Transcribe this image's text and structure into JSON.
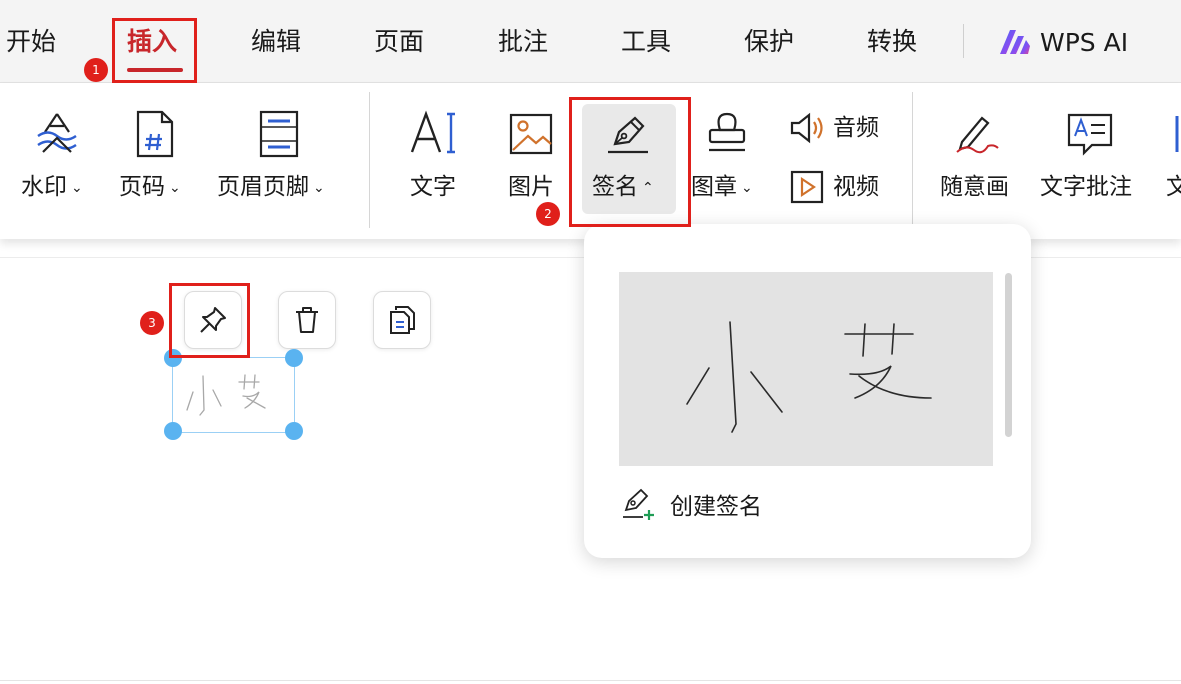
{
  "menu": {
    "tabs": [
      "开始",
      "插入",
      "编辑",
      "页面",
      "批注",
      "工具",
      "保护",
      "转换"
    ],
    "active": "插入",
    "ai_label": "WPS AI"
  },
  "ribbon": {
    "watermark": "水印",
    "page_number": "页码",
    "header_footer": "页眉页脚",
    "text": "文字",
    "image": "图片",
    "signature": "签名",
    "stamp": "图章",
    "audio": "音频",
    "video": "视频",
    "freehand": "随意画",
    "text_comment": "文字批注",
    "cut_label": "文"
  },
  "popup": {
    "create_signature": "创建签名"
  },
  "signature_text": "小艾",
  "annotations": {
    "step1": "1",
    "step2": "2",
    "step3": "3"
  },
  "colors": {
    "accent": "#c8262b",
    "callout": "#e0201b",
    "handle": "#5ab3f0",
    "icon_blue": "#2f5fd1",
    "icon_orange": "#d0722c"
  },
  "icons": {
    "watermark": "watermark-icon",
    "page_number": "page-number-icon",
    "header_footer": "header-footer-icon",
    "text": "text-ai-icon",
    "image": "image-icon",
    "signature": "pen-nib-icon",
    "stamp": "stamp-icon",
    "audio": "speaker-icon",
    "video": "play-icon",
    "freehand": "pencil-icon",
    "text_comment": "text-comment-icon",
    "pin": "pin-icon",
    "delete": "trash-icon",
    "copy": "copy-icon",
    "create_signature": "pen-plus-icon",
    "wps_ai": "wps-ai-logo-icon"
  }
}
